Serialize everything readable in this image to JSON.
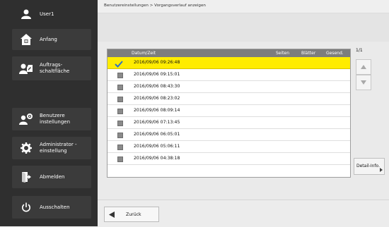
{
  "user": {
    "name": "User1"
  },
  "sidebar": {
    "items": [
      {
        "label": "Anfang",
        "icon": "home-icon"
      },
      {
        "label": "Auftrags-\nschaltfläche",
        "icon": "job-status-icon"
      },
      {
        "label": "Benutzere instellungen",
        "icon": "user-settings-icon"
      },
      {
        "label": "Administrator -\neinstellung",
        "icon": "admin-settings-icon"
      },
      {
        "label": "Abmelden",
        "icon": "logout-icon"
      },
      {
        "label": "Ausschalten",
        "icon": "power-icon"
      }
    ]
  },
  "breadcrumb": "Benutzereinstellungen > Vorgangsverlauf anzeigen",
  "table": {
    "headers": [
      "Datum/Zeit",
      "Seiten",
      "Blätter",
      "Gesend."
    ],
    "rows": [
      {
        "datetime": "2016/09/06 09:26:48",
        "selected": true
      },
      {
        "datetime": "2016/09/06 09:15:01",
        "selected": false
      },
      {
        "datetime": "2016/09/06 08:43:30",
        "selected": false
      },
      {
        "datetime": "2016/09/06 08:23:02",
        "selected": false
      },
      {
        "datetime": "2016/09/06 08:09:14",
        "selected": false
      },
      {
        "datetime": "2016/09/06 07:13:45",
        "selected": false
      },
      {
        "datetime": "2016/09/06 06:05:01",
        "selected": false
      },
      {
        "datetime": "2016/09/06 05:06:11",
        "selected": false
      },
      {
        "datetime": "2016/09/06 04:38:18",
        "selected": false
      }
    ]
  },
  "pagination": {
    "label": "1/1"
  },
  "buttons": {
    "detail": "Detail-Info.",
    "back": "Zurück"
  },
  "colors": {
    "selected_row": "#ffec00",
    "sidebar_bg": "#2f2f2f",
    "header_bg": "#7d7d7d"
  }
}
